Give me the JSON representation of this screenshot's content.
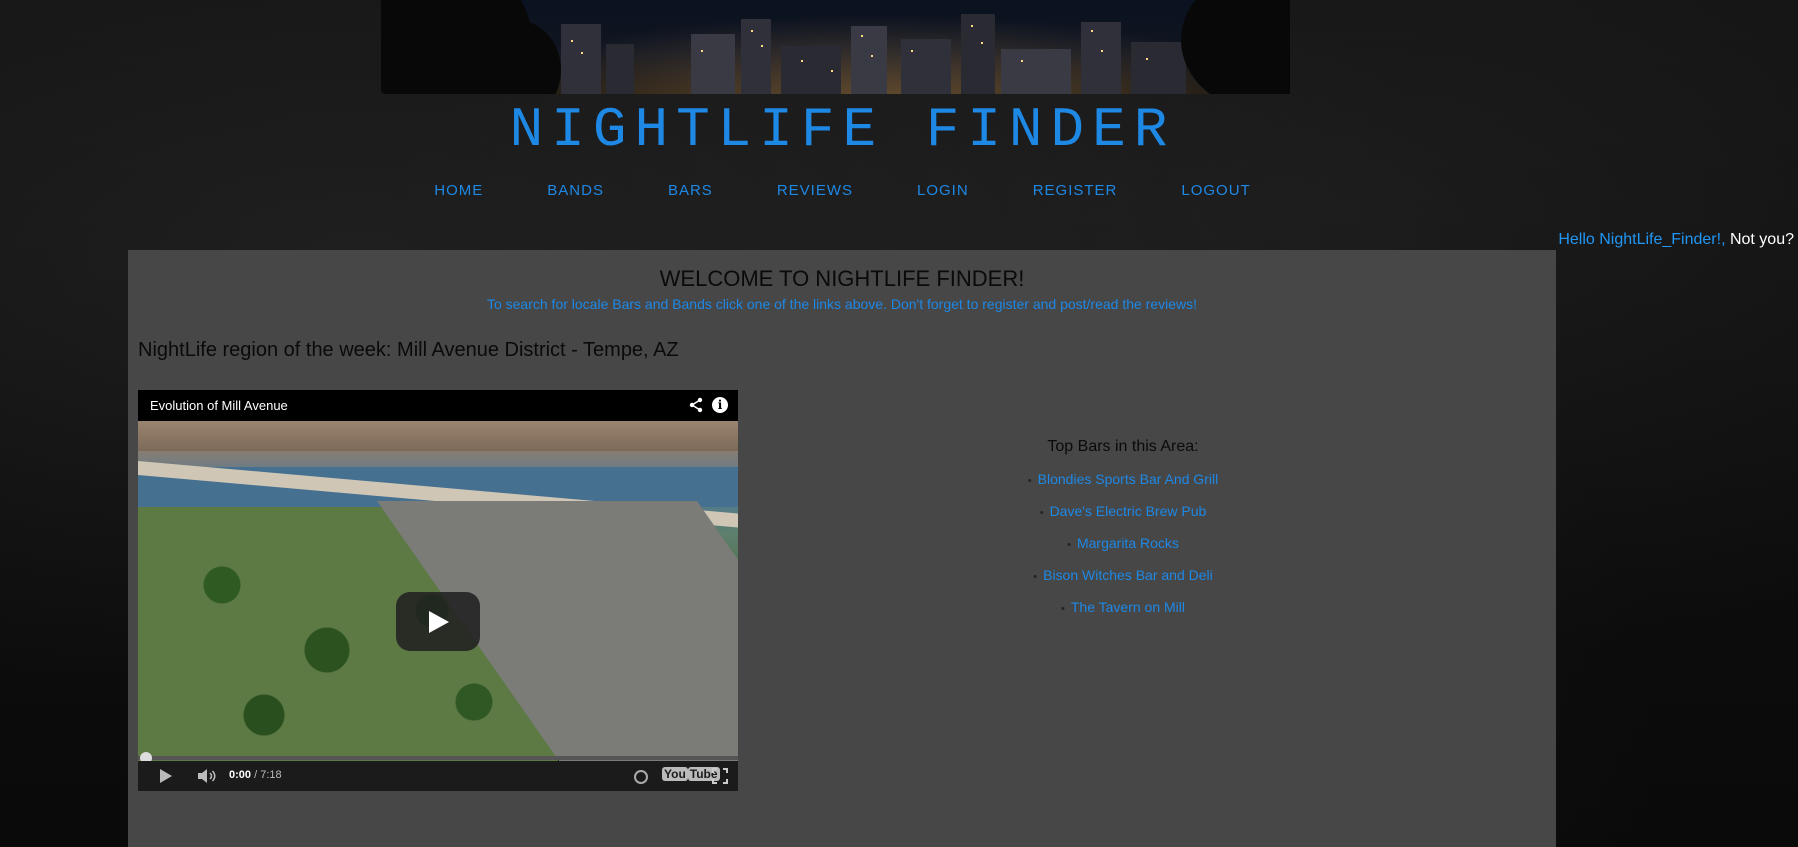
{
  "site": {
    "title": "NIGHTLIFE FINDER"
  },
  "nav": [
    {
      "label": "HOME"
    },
    {
      "label": "BANDS"
    },
    {
      "label": "BARS"
    },
    {
      "label": "REVIEWS"
    },
    {
      "label": "LOGIN"
    },
    {
      "label": "REGISTER"
    },
    {
      "label": "LOGOUT"
    }
  ],
  "greeting": {
    "hello": "Hello NightLife_Finder!,",
    "not_you": " Not you?"
  },
  "welcome": {
    "title": "WELCOME TO NIGHTLIFE FINDER!",
    "subtitle": "To search for locale Bars and Bands click one of the links above. Don't forget to register and post/read the reviews!"
  },
  "region": {
    "heading": "NightLife region of the week: Mill Avenue District - Tempe, AZ"
  },
  "video": {
    "title": "Evolution of Mill Avenue",
    "current_time": "0:00",
    "duration": " / 7:18",
    "youtube_label": "You",
    "youtube_label_tube": "Tube",
    "progress_fraction": 0.0
  },
  "top_bars": {
    "title": "Top Bars in this Area:",
    "items": [
      "Blondies Sports Bar And Grill",
      "Dave's Electric Brew Pub",
      "Margarita Rocks",
      "Bison Witches Bar and Deli",
      "The Tavern on Mill"
    ]
  },
  "colors": {
    "link": "#1e88e5",
    "panel": "#474747",
    "background": "#0d0d0d"
  }
}
